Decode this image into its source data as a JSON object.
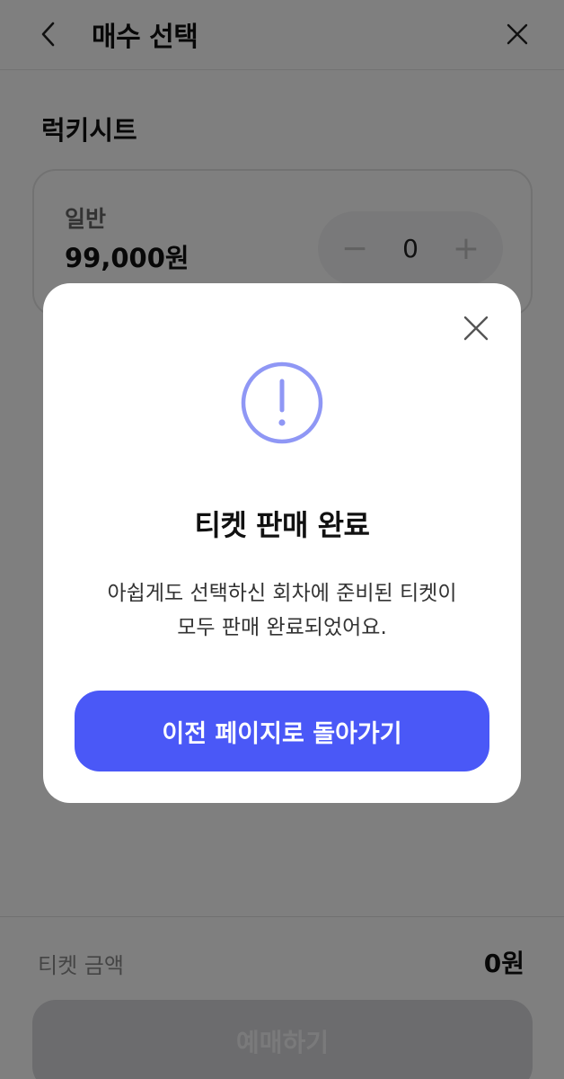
{
  "header": {
    "title": "매수 선택",
    "back_icon": "chevron-left-icon",
    "close_icon": "close-icon"
  },
  "section": {
    "title": "럭키시트"
  },
  "seat": {
    "name": "일반",
    "price": "99,000원",
    "quantity": "0",
    "minus": "−",
    "plus": "+"
  },
  "footer": {
    "total_label": "티켓 금액",
    "total_value": "0원",
    "reserve_label": "예매하기"
  },
  "modal": {
    "icon": "alert-circle-icon",
    "title": "티켓 판매 완료",
    "message_line1": "아쉽게도 선택하신 회차에 준비된 티켓이",
    "message_line2": "모두 판매 완료되었어요.",
    "button_label": "이전 페이지로 돌아가기",
    "accent_color": "#8f97f5",
    "button_color": "#4a58f7"
  }
}
